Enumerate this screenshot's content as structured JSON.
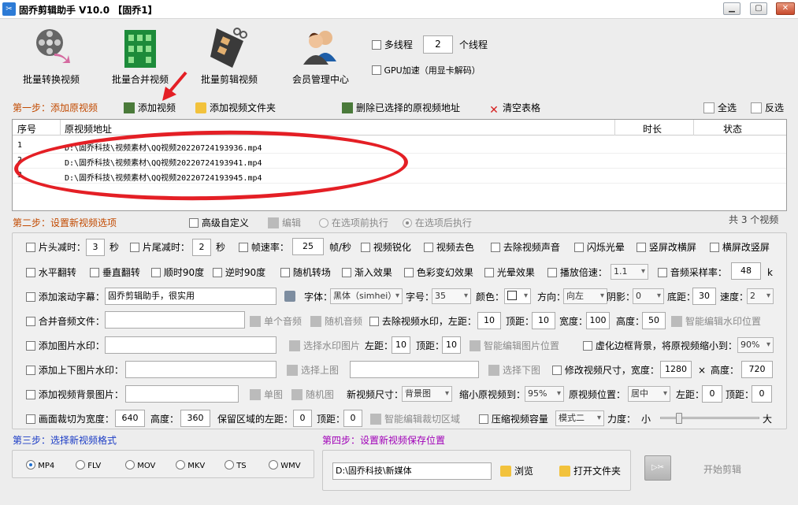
{
  "window": {
    "title": "固乔剪辑助手 V10.0 【固乔1】"
  },
  "toolbar": {
    "items": [
      {
        "label": "批量转换视频"
      },
      {
        "label": "批量合并视频"
      },
      {
        "label": "批量剪辑视频"
      },
      {
        "label": "会员管理中心"
      }
    ],
    "multithread_label": "多线程",
    "thread_count": "2",
    "thread_unit": "个线程",
    "gpu_label": "GPU加速（用显卡解码）"
  },
  "step1": {
    "title": "第一步：添加原视频",
    "add_video": "添加视频",
    "add_folder": "添加视频文件夹",
    "delete_selected": "删除已选择的原视频地址",
    "clear_table": "清空表格",
    "select_all": "全选",
    "invert_select": "反选"
  },
  "table": {
    "columns": {
      "index": "序号",
      "path": "原视频地址",
      "duration": "时长",
      "status": "状态"
    },
    "rows": [
      {
        "index": "1",
        "path": "D:\\固乔科技\\视频素材\\QQ视频20220724193936.mp4"
      },
      {
        "index": "2",
        "path": "D:\\固乔科技\\视频素材\\QQ视频20220724193941.mp4"
      },
      {
        "index": "3",
        "path": "D:\\固乔科技\\视频素材\\QQ视频20220724193945.mp4"
      }
    ]
  },
  "step2": {
    "title": "第二步：设置新视频选项",
    "advanced": "高级自定义",
    "edit": "编辑",
    "before_option": "在选项前执行",
    "after_option": "在选项后执行",
    "count": "共 3 个视频",
    "row1": {
      "head_cut": "片头减时：",
      "head_val": "3",
      "sec1": "秒",
      "tail_cut": "片尾减时：",
      "tail_val": "2",
      "sec2": "秒",
      "fps": "帧速率：",
      "fps_val": "25",
      "fps_unit": "帧/秒",
      "sharpen": "视频锐化",
      "decolor": "视频去色",
      "mute": "去除视频声音",
      "flash": "闪烁光晕",
      "v2h": "竖屏改横屏",
      "h2v": "横屏改竖屏"
    },
    "row2": {
      "hflip": "水平翻转",
      "vflip": "垂直翻转",
      "cw90": "顺时90度",
      "ccw90": "逆时90度",
      "random_trans": "随机转场",
      "fade_in": "渐入效果",
      "color_fx": "色彩变幻效果",
      "halo": "光晕效果",
      "speed": "播放倍速：",
      "speed_val": "1.1",
      "sample_rate": "音频采样率：",
      "sample_val": "48",
      "sample_unit": "k"
    },
    "row3": {
      "scroll_sub": "添加滚动字幕：",
      "scroll_text": "固乔剪辑助手，很实用",
      "font": "字体：",
      "font_val": "黑体（simhei）",
      "size": "字号：",
      "size_val": "35",
      "color": "颜色：",
      "direction": "方向：",
      "direction_val": "向左",
      "shadow": "阴影：",
      "shadow_val": "0",
      "bottom": "底距：",
      "bottom_val": "30",
      "speed": "速度：",
      "speed_val": "2"
    },
    "row4": {
      "merge_audio": "合并音频文件：",
      "single_audio": "单个音频",
      "random_audio": "随机音频",
      "remove_wm": "去除视频水印，左距：",
      "left_val": "10",
      "top": "顶距：",
      "top_val": "10",
      "width": "宽度：",
      "width_val": "100",
      "height": "高度：",
      "height_val": "50",
      "smart_wm": "智能编辑水印位置"
    },
    "row5": {
      "img_wm": "添加图片水印：",
      "choose_wm": "选择水印图片",
      "left": "左距：",
      "left_val": "10",
      "top": "顶距：",
      "top_val": "10",
      "smart_img": "智能编辑图片位置",
      "blur_bg": "虚化边框背景，将原视频缩小到：",
      "blur_val": "90%"
    },
    "row6": {
      "tb_wm": "添加上下图片水印：",
      "choose_top": "选择上图",
      "choose_bottom": "选择下图",
      "resize": "修改视频尺寸，宽度：",
      "w_val": "1280",
      "times": "×",
      "h_label": "高度：",
      "h_val": "720"
    },
    "row7": {
      "bg_img": "添加视频背景图片：",
      "single": "单图",
      "random": "随机图",
      "new_size": "新视频尺寸：",
      "new_size_val": "背景图",
      "shrink": "缩小原视频到：",
      "shrink_val": "95%",
      "pos": "原视频位置：",
      "pos_val": "居中",
      "left": "左距：",
      "left_val": "0",
      "top": "顶距：",
      "top_val": "0"
    },
    "row8": {
      "crop": "画面裁切为宽度：",
      "crop_w": "640",
      "height": "高度：",
      "crop_h": "360",
      "keep_left": "保留区域的左距：",
      "keep_left_val": "0",
      "top": "顶距：",
      "top_val": "0",
      "smart_crop": "智能编辑裁切区域",
      "compress": "压缩视频容量",
      "mode_val": "模式二",
      "strength": "力度：",
      "small": "小",
      "big": "大",
      "strength_level": 0.16
    }
  },
  "step3": {
    "title": "第三步：选择新视频格式",
    "formats": [
      "MP4",
      "FLV",
      "MOV",
      "MKV",
      "TS",
      "WMV"
    ],
    "selected": "MP4"
  },
  "step4": {
    "title": "第四步：设置新视频保存位置",
    "path": "D:\\固乔科技\\新媒体",
    "browse": "浏览",
    "open_folder": "打开文件夹",
    "start": "开始剪辑"
  }
}
